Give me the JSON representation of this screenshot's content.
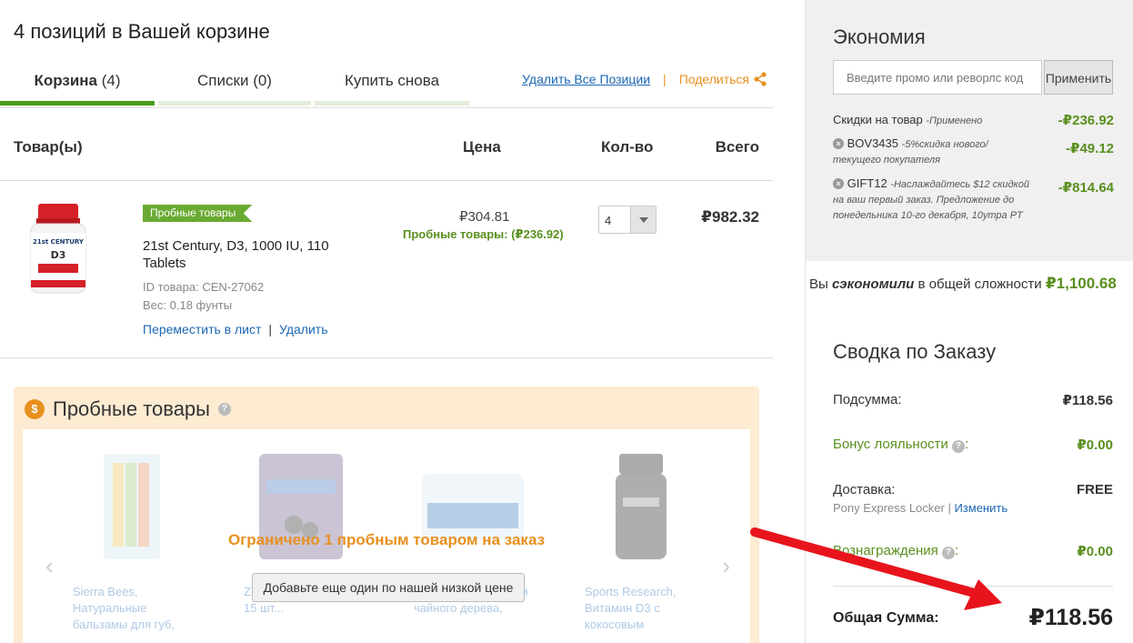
{
  "cart": {
    "title": "4 позиций в Вашей корзине",
    "tabs": [
      {
        "label": "Корзина",
        "count": "(4)"
      },
      {
        "label": "Списки",
        "count": "(0)"
      },
      {
        "label": "Купить снова",
        "count": ""
      }
    ],
    "remove_all": "Удалить Все Позиции",
    "separator": "|",
    "share": "Поделиться"
  },
  "table": {
    "headers": {
      "product": "Товар(ы)",
      "price": "Цена",
      "qty": "Кол-во",
      "total": "Всего"
    }
  },
  "item": {
    "badge": "Пробные товары",
    "name": "21st Century, D3, 1000 IU, 110 Tablets",
    "id_line": "ID товара: CEN-27062",
    "weight_line": "Вес: 0.18 фунты",
    "move_link": "Переместить в лист",
    "bar": "|",
    "delete_link": "Удалить",
    "price": "₽304.81",
    "trial_price": "Пробные товары: (₽236.92)",
    "qty": "4",
    "total": "₽982.32",
    "img_label_brand": "21st CENTURY",
    "img_label_d3": "D3"
  },
  "trial": {
    "title": "Пробные товары",
    "help": "?",
    "coin": "$",
    "limit_text": "Ограничено 1 пробным товаром на заказ",
    "add_button": "Добавьте еще один по нашей низкой цене",
    "products": [
      {
        "text": "Sierra Bees, Натуральные бальзамы для губ,"
      },
      {
        "text": "Z... цинком и цинком, 15 шт..."
      },
      {
        "text": "... бальзам с маслом чайного дерева,"
      },
      {
        "text": "Sports Research, Витамин D3 с кокосовым"
      }
    ],
    "prev": "‹",
    "next": "›"
  },
  "economy": {
    "title": "Экономия",
    "promo_placeholder": "Введите промо или реворлс код",
    "apply": "Применить",
    "discount_label": "Скидки на товар",
    "discount_note": "-Применено",
    "discount_value": "-₽236.92",
    "code1": "BOV3435",
    "code1_note": "-5%скидка нового/текущего покупателя",
    "code1_value": "-₽49.12",
    "code2": "GIFT12",
    "code2_note": "-Наслаждайтесь $12 скидкой на ваш первый заказ. Предложение до понедельника 10-го декабря, 10утра PT",
    "code2_value": "-₽814.64",
    "saved_pre": "Вы",
    "saved_em": "сэкономили",
    "saved_mid": "в общей сложности",
    "saved_value": "₽1,100.68"
  },
  "summary": {
    "title": "Сводка по Заказу",
    "subtotal_label": "Подсумма:",
    "subtotal_value": "₽118.56",
    "loyalty_label": "Бонус лояльности",
    "loyalty_value": "₽0.00",
    "shipping_label": "Доставка:",
    "shipping_value": "FREE",
    "shipping_method": "Pony Express Locker",
    "shipping_change": "Изменить",
    "rewards_label": "Вознаграждения",
    "rewards_value": "₽0.00",
    "grand_label": "Общая Сумма:",
    "grand_value": "₽118.56"
  },
  "colors": {
    "accent_green": "#4a9d1a",
    "price_green": "#5a8f1e",
    "orange": "#e8901e",
    "link": "#1a66b3",
    "arrow": "#e8141c"
  }
}
